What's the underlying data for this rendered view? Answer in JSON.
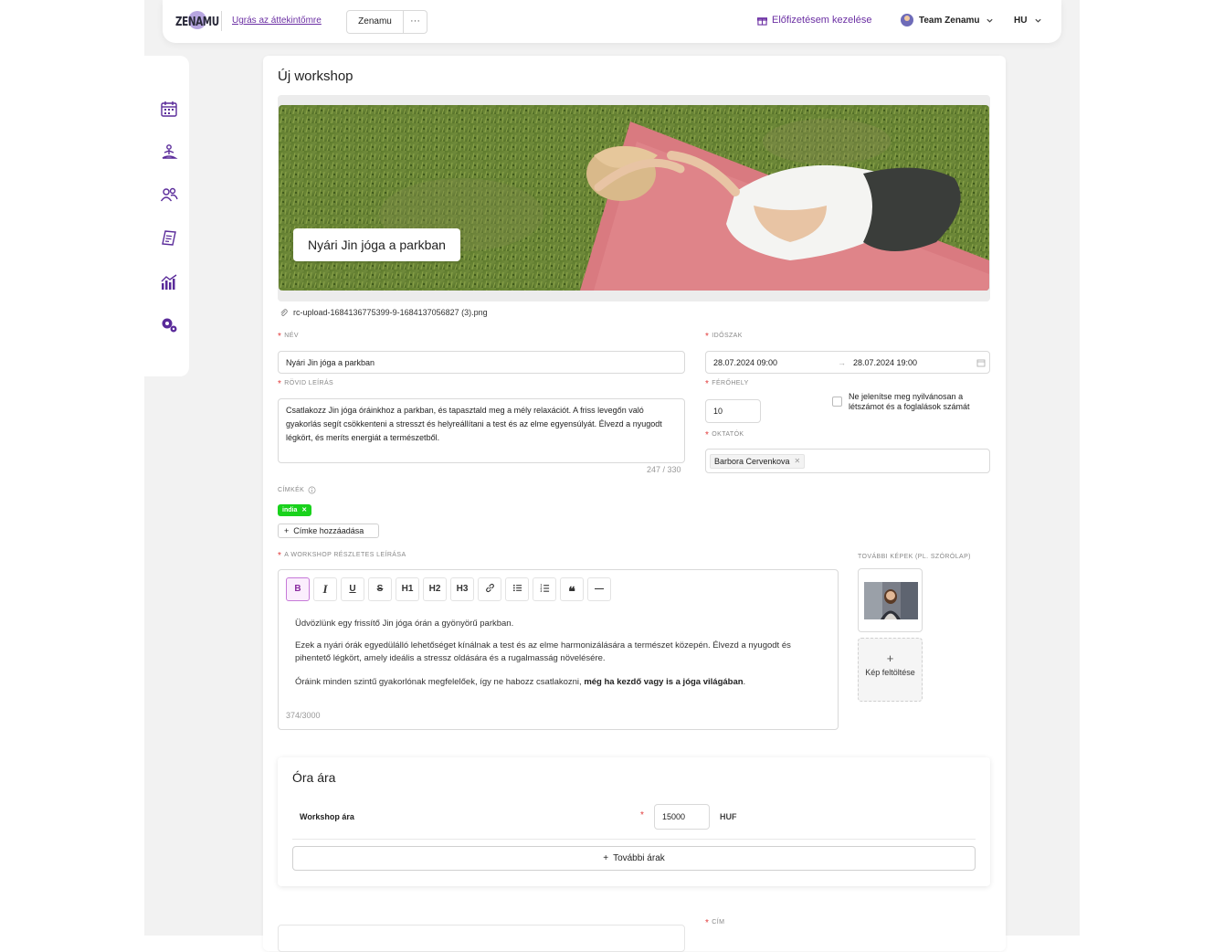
{
  "header": {
    "logo_text": "ZENAMU",
    "overview_link": "Ugrás az áttekintőmre",
    "studio_button": "Zenamu",
    "more_button": "···",
    "subscription_link": "Előfizetésem kezelése",
    "team_name": "Team Zenamu",
    "language": "HU"
  },
  "sidebar": {
    "items": [
      {
        "icon": "calendar-icon"
      },
      {
        "icon": "meditation-icon"
      },
      {
        "icon": "users-icon"
      },
      {
        "icon": "receipt-icon"
      },
      {
        "icon": "statistics-icon"
      },
      {
        "icon": "settings-icon"
      }
    ]
  },
  "page": {
    "title": "Új workshop",
    "hero_title": "Nyári Jin jóga a parkban",
    "file_name": "rc-upload-1684136775399-9-1684137056827 (3).png"
  },
  "form": {
    "name_label": "NÉV",
    "name_value": "Nyári Jin jóga a parkban",
    "period_label": "IDŐSZAK",
    "period_start": "28.07.2024 09:00",
    "period_arrow": "→",
    "period_end": "28.07.2024 19:00",
    "short_desc_label": "RÖVID LEÍRÁS",
    "short_desc_value": "Csatlakozz Jin jóga óráinkhoz a parkban, és tapasztald meg a mély relaxációt. A friss levegőn való gyakorlás segít csökkenteni a stresszt és helyreállítani a test és az elme egyensúlyát. Élvezd a nyugodt légkört, és meríts energiát a természetből.",
    "short_desc_counter": "247 / 330",
    "capacity_label": "FÉRŐHELY",
    "capacity_value": "10",
    "hide_capacity_text": "Ne jelenítse meg nyilvánosan a létszámot és a foglalások számát",
    "instructors_label": "OKTATÓK",
    "instructor_chip": "Barbora Cervenkova",
    "tags_label": "CÍMKÉK",
    "tag": "india",
    "add_tag": "Címke hozzáadása",
    "detail_label": "A WORKSHOP RÉSZLETES LEÍRÁSA",
    "extra_images_label": "TOVÁBBI KÉPEK (PL. SZÓRÓLAP)",
    "upload_label": "Kép feltöltése",
    "bottom_label": "CÍM"
  },
  "editor": {
    "toolbar": [
      "B",
      "I",
      "U",
      "S",
      "H1",
      "H2",
      "H3",
      "link",
      "ul",
      "ol",
      "quote",
      "hr"
    ],
    "p1": "Üdvözlünk egy frissítő Jin jóga órán a gyönyörű parkban.",
    "p2": "Ezek a nyári órák egyedülálló lehetőséget kínálnak a test és az elme harmonizálására a természet közepén. Élvezd a nyugodt és pihentető légkört, amely ideális a stressz oldására és a rugalmasság növelésére.",
    "p3_plain": "Óráink minden szintű gyakorlónak megfelelőek, így ne habozz csatlakozni, ",
    "p3_bold": "még ha kezdő vagy is a jóga világában",
    "p3_end": ".",
    "counter": "374/3000"
  },
  "pricing": {
    "title": "Óra ára",
    "row_label": "Workshop ára",
    "value": "15000",
    "currency": "HUF",
    "more_prices": "További árak"
  },
  "colors": {
    "accent": "#6b2fa3",
    "required": "#e23b3b",
    "tag_green": "#19d21c"
  }
}
